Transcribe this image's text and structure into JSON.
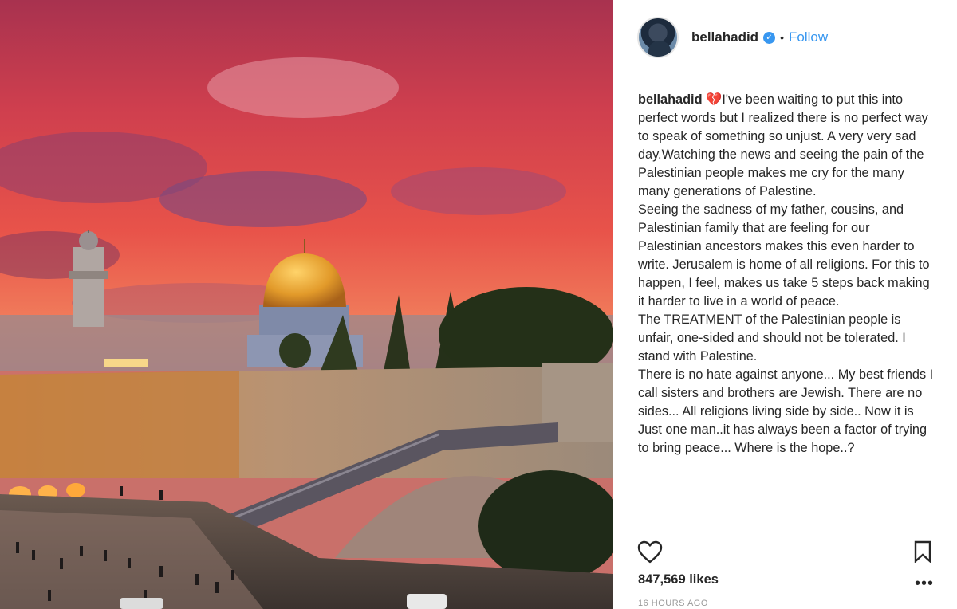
{
  "post": {
    "image_alt": "Sunset over the Western Wall and Dome of the Rock in Jerusalem",
    "header": {
      "username": "bellahadid",
      "verified_icon": "verified-badge-icon",
      "separator": "•",
      "follow_label": "Follow"
    },
    "caption": {
      "username": "bellahadid",
      "emoji": "💔",
      "text": "I've been waiting to put this into perfect words but I realized there is no perfect way to speak of something so unjust. A very very sad day.Watching the news and seeing the pain of the Palestinian people makes me cry for the many many generations of Palestine.\nSeeing the sadness of my father, cousins, and Palestinian family that are feeling for our Palestinian ancestors makes this even harder to write. Jerusalem is home of all religions. For this to happen, I feel, makes us take 5 steps back making it harder to live in a world of peace.\nThe TREATMENT of the Palestinian people is unfair, one-sided and should not be tolerated. I stand with Palestine.\nThere is no hate against anyone... My best friends I call sisters and brothers are Jewish. There are no sides... All religions living side by side.. Now it is Just one man..it has always been a factor of trying to bring peace... Where is the hope..?"
    },
    "actions": {
      "like_icon": "heart-outline-icon",
      "save_icon": "bookmark-icon",
      "more_icon": "more-options-icon",
      "more_label": "•••"
    },
    "likes": "847,569 likes",
    "timestamp": "16 HOURS AGO"
  },
  "colors": {
    "link_blue": "#3897f0",
    "text": "#262626",
    "muted": "#999999"
  }
}
